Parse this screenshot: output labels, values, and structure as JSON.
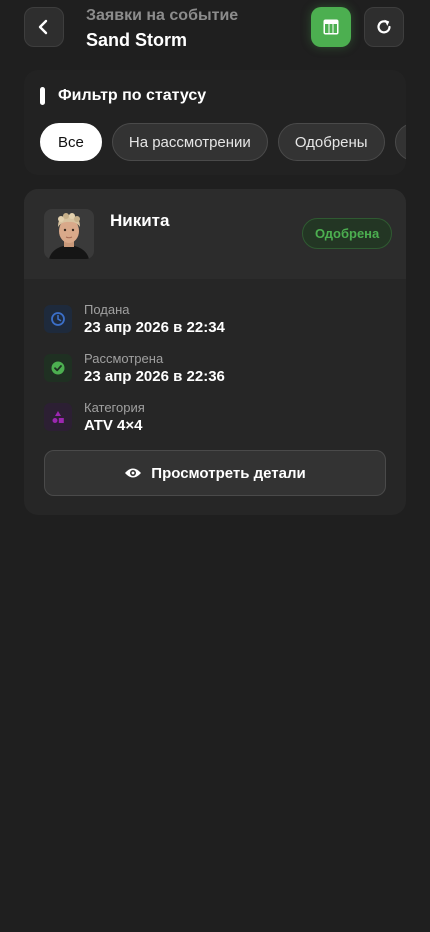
{
  "header": {
    "subtitle": "Заявки на событие",
    "title": "Sand Storm",
    "back_icon": "chevron-left-icon",
    "table_icon": "table-icon",
    "refresh_icon": "refresh-icon",
    "accent_color": "#4caf50"
  },
  "filter": {
    "title": "Фильтр по статусу",
    "chips": [
      {
        "label": "Все",
        "active": true
      },
      {
        "label": "На рассмотрении",
        "active": false
      },
      {
        "label": "Одобрены",
        "active": false
      },
      {
        "label": "",
        "active": false
      }
    ]
  },
  "application": {
    "name": "Никита",
    "status": "Одобрена",
    "status_color": "#4caf50",
    "rows": [
      {
        "label": "Подана",
        "value": "23 апр 2026 в 22:34",
        "icon": "clock-icon",
        "color": "#3b6fc9"
      },
      {
        "label": "Рассмотрена",
        "value": "23 апр 2026 в 22:36",
        "icon": "check-circle-icon",
        "color": "#4caf50"
      },
      {
        "label": "Категория",
        "value": "ATV 4×4",
        "icon": "shapes-icon",
        "color": "#9c27b0"
      }
    ],
    "details_button": "Просмотреть детали",
    "details_icon": "eye-icon"
  }
}
